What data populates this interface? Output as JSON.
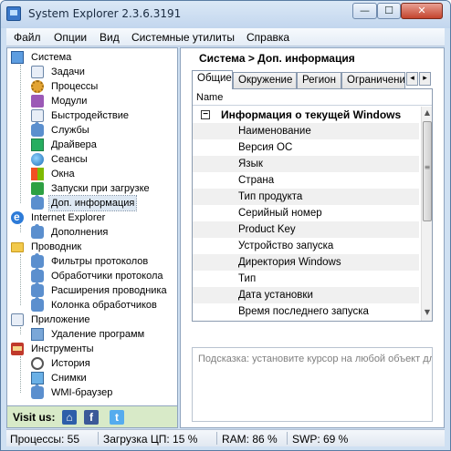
{
  "window": {
    "title": "System Explorer 2.3.6.3191",
    "min_glyph": "—",
    "max_glyph": "☐",
    "close_glyph": "✕"
  },
  "menu": [
    "Файл",
    "Опции",
    "Вид",
    "Системные утилиты",
    "Справка"
  ],
  "tree": {
    "system": "Система",
    "system_items": [
      "Задачи",
      "Процессы",
      "Модули",
      "Быстродействие",
      "Службы",
      "Драйвера",
      "Сеансы",
      "Окна",
      "Запуски при загрузке",
      "Доп. информация"
    ],
    "ie": "Internet Explorer",
    "ie_items": [
      "Дополнения"
    ],
    "explorer": "Проводник",
    "explorer_items": [
      "Фильтры протоколов",
      "Обработчики протокола",
      "Расширения проводника",
      "Колонка обработчиков"
    ],
    "apps": "Приложение",
    "apps_items": [
      "Удаление программ"
    ],
    "tools": "Инструменты",
    "tools_items": [
      "История",
      "Снимки",
      "WMI-браузер"
    ]
  },
  "visit": {
    "label": "Visit us:",
    "home_glyph": "⌂",
    "fb_glyph": "f",
    "tw_glyph": "t"
  },
  "breadcrumb": "Система > Доп. информация",
  "tabs": [
    "Общие",
    "Окружение",
    "Регион",
    "Ограничени"
  ],
  "tab_arrows": [
    "◂",
    "▸"
  ],
  "grid": {
    "column": "Name",
    "group": "Информация о текущей Windows",
    "group_toggle": "−",
    "rows": [
      "Наименование",
      "Версия ОС",
      "Язык",
      "Страна",
      "Тип продукта",
      "Серийный номер",
      "Product Key",
      "Устройство запуска",
      "Директория Windows",
      "Тип",
      "Дата установки",
      "Время последнего запуска"
    ],
    "scroll_up": "▲",
    "scroll_down": "▼",
    "thumb_grip": "≡"
  },
  "hint": "Подсказка: установите курсор на любой объект для получения справки",
  "status": {
    "processes": "Процессы: 55",
    "cpu": "Загрузка ЦП: 15 %",
    "ram": "RAM: 86 %",
    "swp": "SWP: 69 %"
  }
}
